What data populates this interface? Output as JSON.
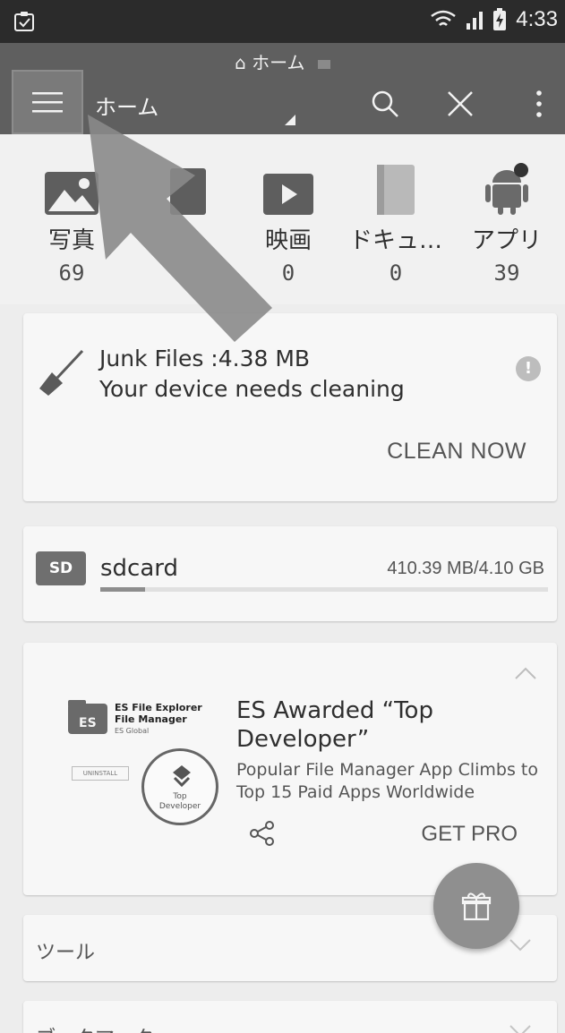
{
  "status_bar": {
    "time": "4:33"
  },
  "app_bar": {
    "overlay_title": "ホーム",
    "title": "ホーム"
  },
  "categories": [
    {
      "label": "写真",
      "count": "69",
      "icon": "image-icon"
    },
    {
      "label": "",
      "count": "",
      "icon": "music-icon"
    },
    {
      "label": "映画",
      "count": "0",
      "icon": "video-icon"
    },
    {
      "label": "ドキュ…",
      "count": "0",
      "icon": "document-icon"
    },
    {
      "label": "アプリ",
      "count": "39",
      "icon": "android-icon"
    }
  ],
  "junk": {
    "line1": "Junk Files :4.38 MB",
    "line2": "Your device needs cleaning",
    "action": "CLEAN NOW"
  },
  "storage": {
    "name": "sdcard",
    "usage": "410.39 MB/4.10 GB",
    "used_fraction": 0.1,
    "icon_label": "SD"
  },
  "promo": {
    "image_app_name": "ES File Explorer File Manager",
    "image_app_sub": "ES Global",
    "image_uninstall": "UNINSTALL",
    "badge_text_1": "Top",
    "badge_text_2": "Developer",
    "title": "ES Awarded “Top Developer”",
    "description": "Popular File Manager App Climbs to Top 15 Paid Apps Worldwide",
    "action": "GET PRO"
  },
  "sections": [
    {
      "label": "ツール"
    },
    {
      "label": "ブックマーク"
    }
  ],
  "colors": {
    "app_bar": "#5f5f5f",
    "status_bar": "#2b2b2b",
    "fab": "#8f8f8f",
    "background": "#ededed"
  }
}
